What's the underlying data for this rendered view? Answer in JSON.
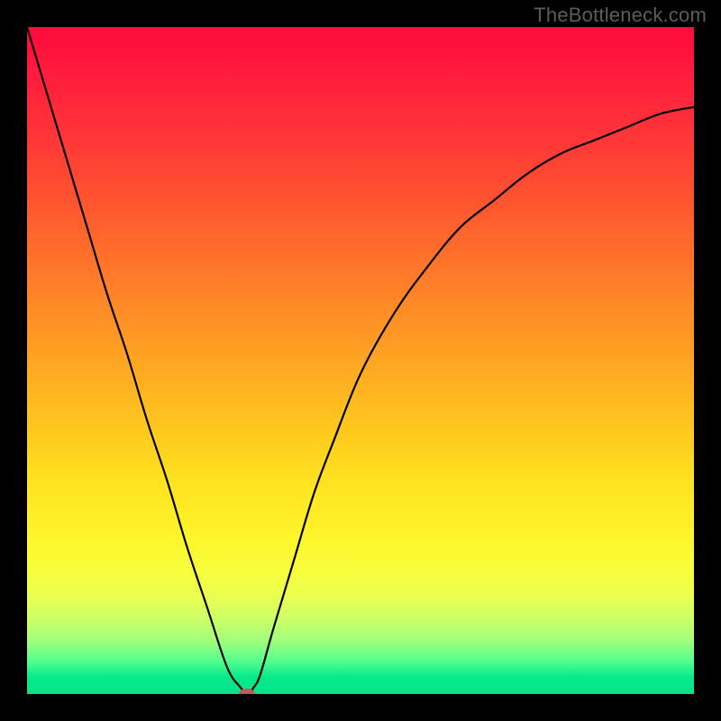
{
  "watermark": "TheBottleneck.com",
  "colors": {
    "frame": "#000000",
    "curve": "#000000",
    "marker": "#c55a5a",
    "gradient_top": "#ff0a3c",
    "gradient_bottom": "#06e28a"
  },
  "chart_data": {
    "type": "line",
    "title": "",
    "xlabel": "",
    "ylabel": "",
    "xlim": [
      0,
      100
    ],
    "ylim": [
      0,
      100
    ],
    "grid": false,
    "legend": false,
    "x": [
      0,
      3,
      6,
      9,
      12,
      15,
      18,
      21,
      24,
      27,
      30,
      32,
      33,
      34,
      35,
      37,
      40,
      43,
      46,
      50,
      55,
      60,
      65,
      70,
      75,
      80,
      85,
      90,
      95,
      100
    ],
    "values": [
      100,
      90,
      80,
      70,
      60,
      51,
      41,
      32,
      22,
      13,
      4,
      1,
      0,
      1,
      3,
      10,
      20,
      30,
      38,
      48,
      57,
      64,
      70,
      74,
      78,
      81,
      83,
      85,
      87,
      88
    ],
    "minimum_marker": {
      "x": 33,
      "y": 0
    },
    "notes": "V-shaped bottleneck curve over a red-to-green vertical gradient. Minimum near x≈33 at y≈0. Left branch nearly linear descending from 100 at x=0; right branch rises with decreasing slope toward ~88 at x=100."
  }
}
